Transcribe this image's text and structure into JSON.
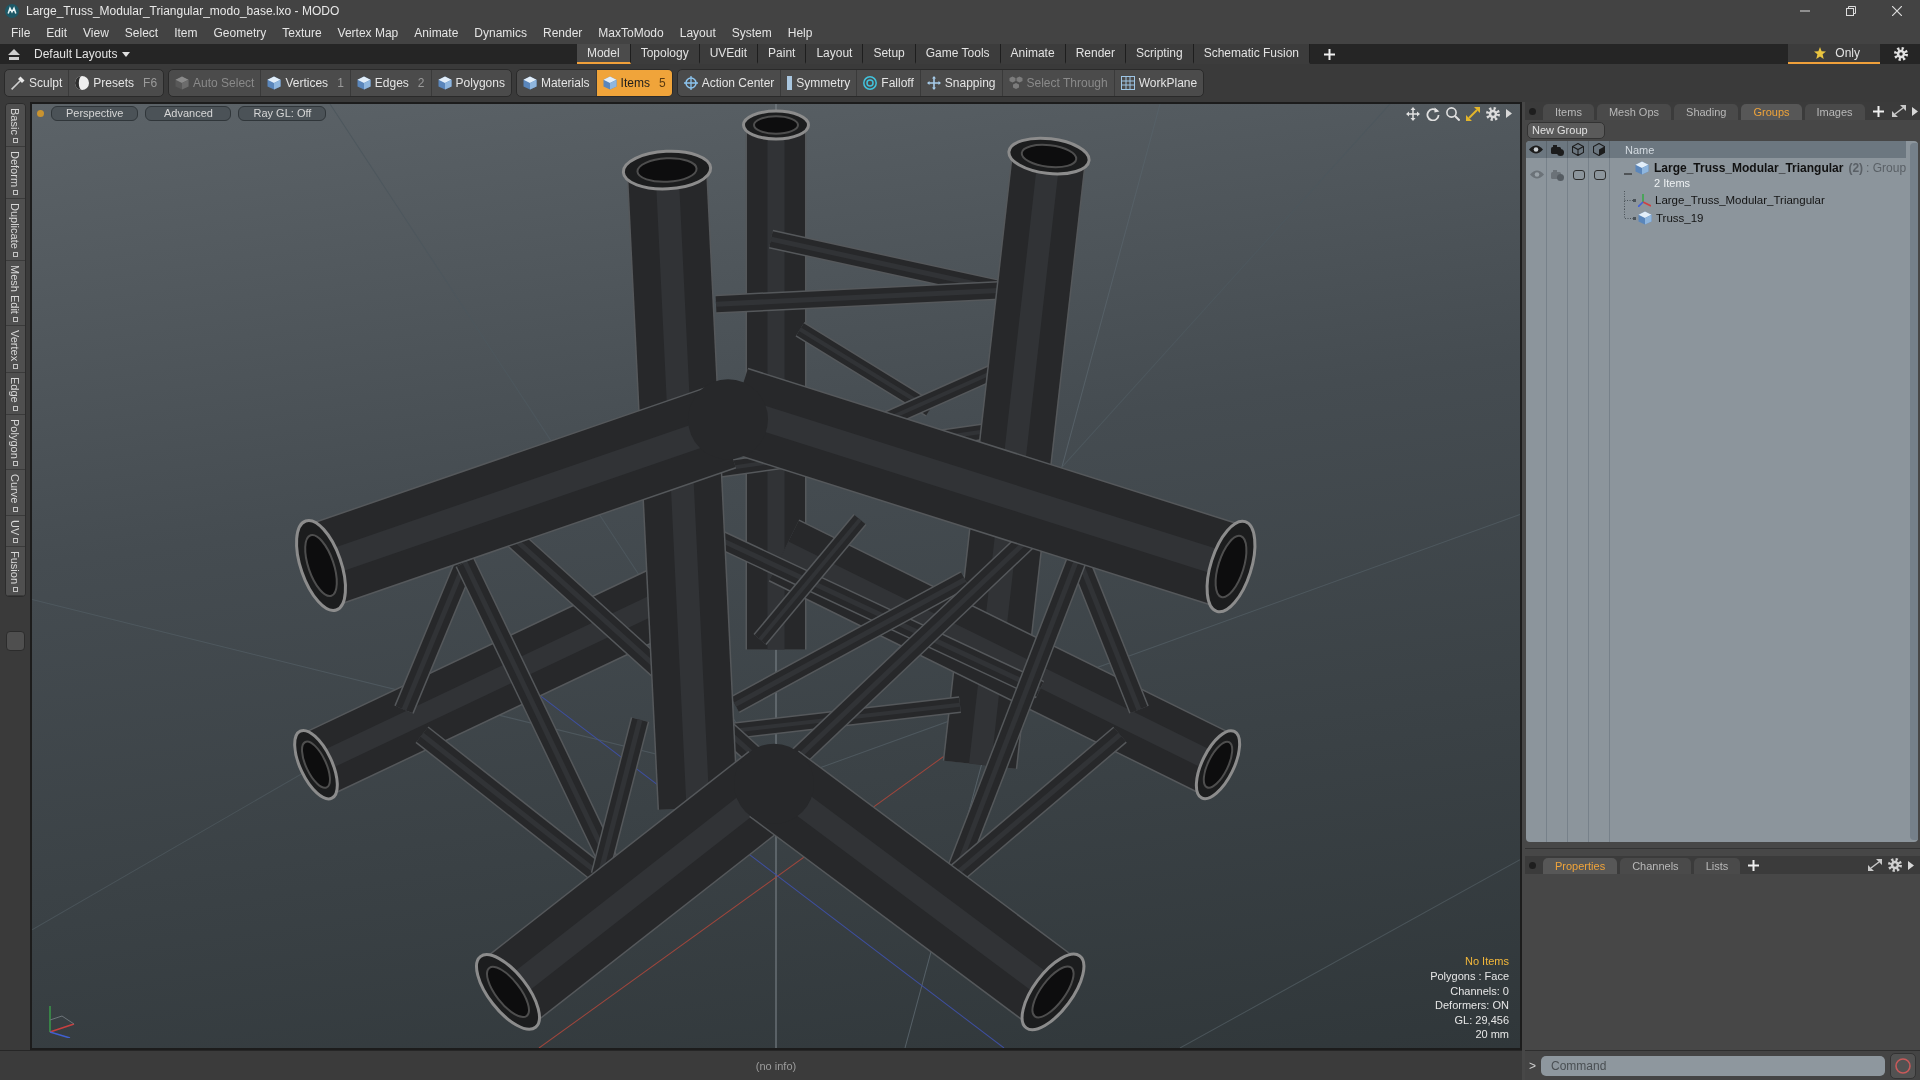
{
  "window": {
    "title": "Large_Truss_Modular_Triangular_modo_base.lxo - MODO"
  },
  "menu": [
    "File",
    "Edit",
    "View",
    "Select",
    "Item",
    "Geometry",
    "Texture",
    "Vertex Map",
    "Animate",
    "Dynamics",
    "Render",
    "MaxToModo",
    "Layout",
    "System",
    "Help"
  ],
  "layout_bar": {
    "layout_menu": "Default Layouts",
    "tabs": [
      {
        "label": "Model",
        "selected": true
      },
      {
        "label": "Topology",
        "selected": false
      },
      {
        "label": "UVEdit",
        "selected": false
      },
      {
        "label": "Paint",
        "selected": false
      },
      {
        "label": "Layout",
        "selected": false
      },
      {
        "label": "Setup",
        "selected": false
      },
      {
        "label": "Game Tools",
        "selected": false
      },
      {
        "label": "Animate",
        "selected": false
      },
      {
        "label": "Render",
        "selected": false
      },
      {
        "label": "Scripting",
        "selected": false
      },
      {
        "label": "Schematic Fusion",
        "selected": false
      }
    ],
    "filter": {
      "label": "Only",
      "on": true
    }
  },
  "toolbar": {
    "groups": [
      [
        {
          "label": "Sculpt",
          "selected": false,
          "disabled": false
        },
        {
          "label": "Presets",
          "shortcut": "F6",
          "selected": false,
          "disabled": false
        }
      ],
      [
        {
          "label": "Auto Select",
          "selected": false,
          "disabled": true
        },
        {
          "label": "Vertices",
          "shortcut": "1",
          "selected": false,
          "disabled": false
        },
        {
          "label": "Edges",
          "shortcut": "2",
          "selected": false,
          "disabled": false
        },
        {
          "label": "Polygons",
          "selected": false,
          "disabled": false
        }
      ],
      [
        {
          "label": "Materials",
          "selected": false,
          "disabled": false
        },
        {
          "label": "Items",
          "shortcut": "5",
          "selected": true,
          "disabled": false
        }
      ],
      [
        {
          "label": "Action Center",
          "selected": false,
          "disabled": false
        },
        {
          "label": "Symmetry",
          "selected": false,
          "disabled": false
        },
        {
          "label": "Falloff",
          "selected": false,
          "disabled": false
        },
        {
          "label": "Snapping",
          "selected": false,
          "disabled": false
        },
        {
          "label": "Select Through",
          "selected": false,
          "disabled": true
        },
        {
          "label": "WorkPlane",
          "selected": false,
          "disabled": false
        }
      ]
    ]
  },
  "tool_tabs": [
    "Basic",
    "Deform",
    "Duplicate",
    "Mesh Edit",
    "Vertex",
    "Edge",
    "Polygon",
    "Curve",
    "UV",
    "Fusion"
  ],
  "viewport": {
    "buttons": [
      "Perspective",
      "Advanced",
      "Ray GL: Off"
    ],
    "info": {
      "selection": "No Items",
      "lines": [
        "Polygons : Face",
        "Channels: 0",
        "Deformers: ON",
        "GL: 29,456",
        "20 mm"
      ]
    }
  },
  "status_bar": {
    "text": "(no info)"
  },
  "groups_panel": {
    "tabs": [
      {
        "label": "Items",
        "selected": false
      },
      {
        "label": "Mesh Ops",
        "selected": false
      },
      {
        "label": "Shading",
        "selected": false
      },
      {
        "label": "Groups",
        "selected": true
      },
      {
        "label": "Images",
        "selected": false
      }
    ],
    "new_group_button": "New Group",
    "name_column": "Name",
    "rows": [
      {
        "name": "Large_Truss_Modular_Triangular",
        "count": "(2)",
        "type": ": Group",
        "subtitle": "2 Items",
        "expanded": true,
        "children": [
          {
            "kind": "locator",
            "name": "Large_Truss_Modular_Triangular"
          },
          {
            "kind": "mesh",
            "name": "Truss_19"
          }
        ]
      }
    ]
  },
  "properties_panel": {
    "tabs": [
      {
        "label": "Properties",
        "selected": true
      },
      {
        "label": "Channels",
        "selected": false
      },
      {
        "label": "Lists",
        "selected": false
      }
    ]
  },
  "command_bar": {
    "prompt": ">",
    "placeholder": "Command"
  }
}
